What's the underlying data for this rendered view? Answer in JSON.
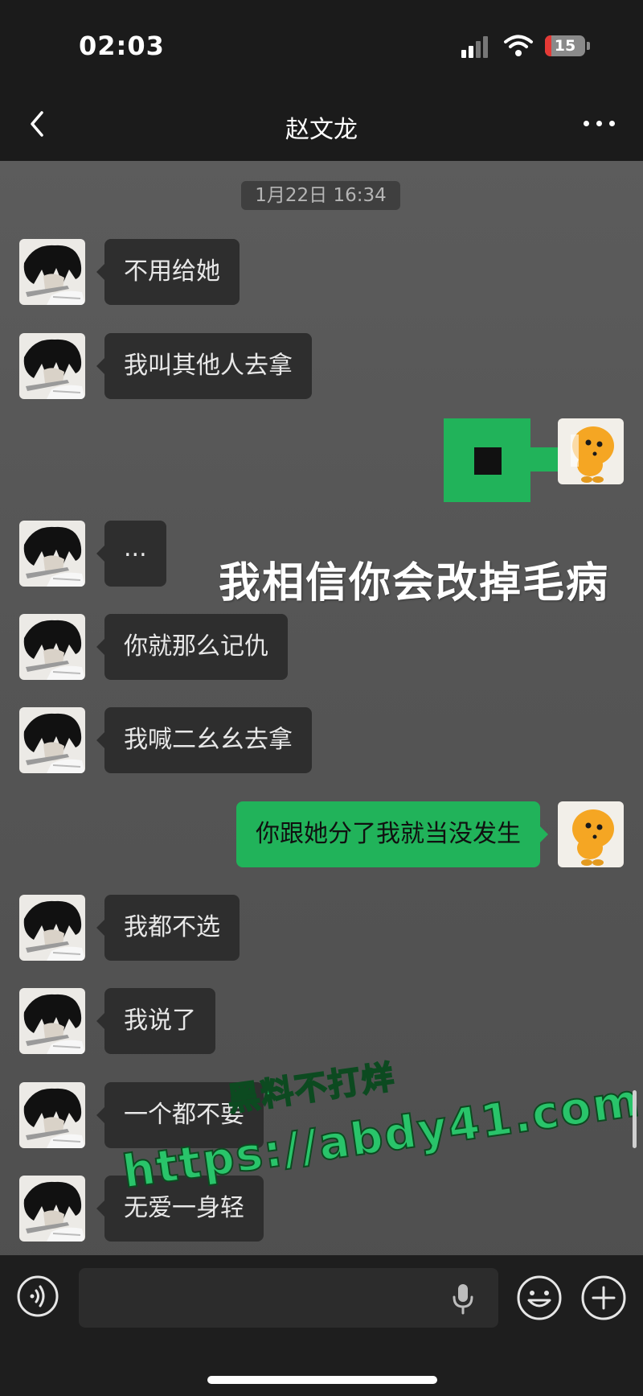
{
  "status_bar": {
    "time": "02:03",
    "battery": "15",
    "battery_level": 0.15
  },
  "nav": {
    "title": "赵文龙"
  },
  "chat": {
    "timestamp": "1月22日 16:34",
    "messages": [
      {
        "side": "in",
        "text": "不用给她"
      },
      {
        "side": "in",
        "text": "我叫其他人去拿"
      },
      {
        "side": "out",
        "text": ""
      },
      {
        "side": "in",
        "text": "..."
      },
      {
        "side": "in",
        "text": "你就那么记仇"
      },
      {
        "side": "in",
        "text": "我喊二幺幺去拿"
      },
      {
        "side": "out",
        "text": "你跟她分了我就当没发生"
      },
      {
        "side": "in",
        "text": "我都不选"
      },
      {
        "side": "in",
        "text": "我说了"
      },
      {
        "side": "in",
        "text": "一个都不要"
      },
      {
        "side": "in",
        "text": "无爱一身轻"
      }
    ]
  },
  "overlay": {
    "caption": "我相信你会改掉毛病"
  },
  "watermark": {
    "line1": "黑料不打烊",
    "line2": "https://abdy41.com"
  },
  "input": {
    "placeholder": ""
  },
  "colors": {
    "outgoing_bubble": "#21b35a",
    "incoming_bubble": "#2e2e2e",
    "bar_background": "#1b1b1b"
  }
}
